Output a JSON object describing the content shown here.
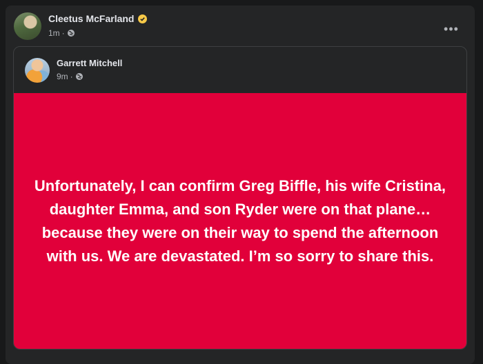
{
  "post": {
    "author": "Cleetus McFarland",
    "time": "1m",
    "separator": "·",
    "verified_color": "#f7c948",
    "more_icon": "more-horizontal-icon",
    "privacy_icon": "globe-icon"
  },
  "shared_post": {
    "author": "Garrett Mitchell",
    "time": "9m",
    "separator": "·",
    "privacy_icon": "globe-icon",
    "background_color": "#e1003a",
    "text": "Unfortunately, I can confirm Greg Biffle, his wife Cristina, daughter Emma, and son Ryder were on that plane… because they were on their way to spend the afternoon with us. We are devastated. I’m so sorry to share this."
  }
}
